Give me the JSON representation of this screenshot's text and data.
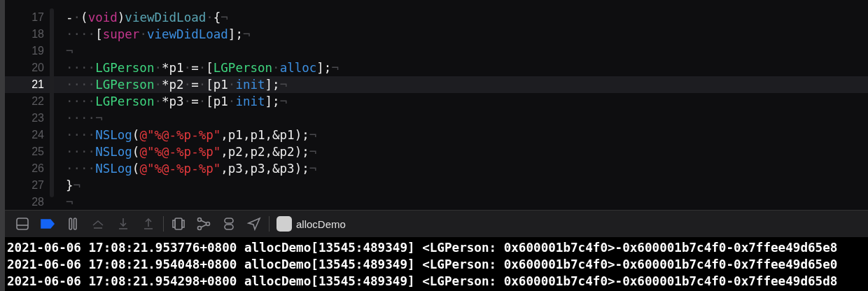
{
  "editor": {
    "lines": [
      {
        "number": "17",
        "selected": false,
        "tokens": [
          {
            "kind": "plain",
            "text": "-"
          },
          {
            "kind": "invisible",
            "text": "·"
          },
          {
            "kind": "plain",
            "text": "("
          },
          {
            "kind": "keyword",
            "text": "void"
          },
          {
            "kind": "plain",
            "text": ")"
          },
          {
            "kind": "decl",
            "text": "viewDidLoad"
          },
          {
            "kind": "invisible",
            "text": "·"
          },
          {
            "kind": "plain",
            "text": "{"
          },
          {
            "kind": "invisible",
            "text": "¬"
          }
        ]
      },
      {
        "number": "18",
        "selected": false,
        "tokens": [
          {
            "kind": "invisible",
            "text": "····"
          },
          {
            "kind": "plain",
            "text": "["
          },
          {
            "kind": "keyword",
            "text": "super"
          },
          {
            "kind": "invisible",
            "text": "·"
          },
          {
            "kind": "method",
            "text": "viewDidLoad"
          },
          {
            "kind": "plain",
            "text": "];"
          },
          {
            "kind": "invisible",
            "text": "¬"
          }
        ]
      },
      {
        "number": "19",
        "selected": false,
        "tokens": [
          {
            "kind": "invisible",
            "text": "¬"
          }
        ]
      },
      {
        "number": "20",
        "selected": false,
        "tokens": [
          {
            "kind": "invisible",
            "text": "····"
          },
          {
            "kind": "class",
            "text": "LGPerson"
          },
          {
            "kind": "invisible",
            "text": "·"
          },
          {
            "kind": "plain",
            "text": "*p1"
          },
          {
            "kind": "invisible",
            "text": "·"
          },
          {
            "kind": "plain",
            "text": "="
          },
          {
            "kind": "invisible",
            "text": "·"
          },
          {
            "kind": "plain",
            "text": "["
          },
          {
            "kind": "class",
            "text": "LGPerson"
          },
          {
            "kind": "invisible",
            "text": "·"
          },
          {
            "kind": "method",
            "text": "alloc"
          },
          {
            "kind": "plain",
            "text": "];"
          },
          {
            "kind": "invisible",
            "text": "¬"
          }
        ]
      },
      {
        "number": "21",
        "selected": true,
        "tokens": [
          {
            "kind": "invisible",
            "text": "····"
          },
          {
            "kind": "class",
            "text": "LGPerson"
          },
          {
            "kind": "invisible",
            "text": "·"
          },
          {
            "kind": "plain",
            "text": "*p2"
          },
          {
            "kind": "invisible",
            "text": "·"
          },
          {
            "kind": "plain",
            "text": "="
          },
          {
            "kind": "invisible",
            "text": "·"
          },
          {
            "kind": "plain",
            "text": "[p1"
          },
          {
            "kind": "invisible",
            "text": "·"
          },
          {
            "kind": "method",
            "text": "init"
          },
          {
            "kind": "plain",
            "text": "];"
          },
          {
            "kind": "invisible",
            "text": "¬"
          }
        ]
      },
      {
        "number": "22",
        "selected": false,
        "tokens": [
          {
            "kind": "invisible",
            "text": "····"
          },
          {
            "kind": "class",
            "text": "LGPerson"
          },
          {
            "kind": "invisible",
            "text": "·"
          },
          {
            "kind": "plain",
            "text": "*p3"
          },
          {
            "kind": "invisible",
            "text": "·"
          },
          {
            "kind": "plain",
            "text": "="
          },
          {
            "kind": "invisible",
            "text": "·"
          },
          {
            "kind": "plain",
            "text": "[p1"
          },
          {
            "kind": "invisible",
            "text": "·"
          },
          {
            "kind": "method",
            "text": "init"
          },
          {
            "kind": "plain",
            "text": "];"
          },
          {
            "kind": "invisible",
            "text": "¬"
          }
        ]
      },
      {
        "number": "23",
        "selected": false,
        "tokens": [
          {
            "kind": "invisible",
            "text": "····¬"
          }
        ]
      },
      {
        "number": "24",
        "selected": false,
        "tokens": [
          {
            "kind": "invisible",
            "text": "····"
          },
          {
            "kind": "method",
            "text": "NSLog"
          },
          {
            "kind": "plain",
            "text": "("
          },
          {
            "kind": "string",
            "text": "@\"%@-%p-%p\""
          },
          {
            "kind": "plain",
            "text": ",p1,p1,&p1);"
          },
          {
            "kind": "invisible",
            "text": "¬"
          }
        ]
      },
      {
        "number": "25",
        "selected": false,
        "tokens": [
          {
            "kind": "invisible",
            "text": "····"
          },
          {
            "kind": "method",
            "text": "NSLog"
          },
          {
            "kind": "plain",
            "text": "("
          },
          {
            "kind": "string",
            "text": "@\"%@-%p-%p\""
          },
          {
            "kind": "plain",
            "text": ",p2,p2,&p2);"
          },
          {
            "kind": "invisible",
            "text": "¬"
          }
        ]
      },
      {
        "number": "26",
        "selected": false,
        "tokens": [
          {
            "kind": "invisible",
            "text": "····"
          },
          {
            "kind": "method",
            "text": "NSLog"
          },
          {
            "kind": "plain",
            "text": "("
          },
          {
            "kind": "string",
            "text": "@\"%@-%p-%p\""
          },
          {
            "kind": "plain",
            "text": ",p3,p3,&p3);"
          },
          {
            "kind": "invisible",
            "text": "¬"
          }
        ]
      },
      {
        "number": "27",
        "selected": false,
        "tokens": [
          {
            "kind": "plain",
            "text": "}"
          },
          {
            "kind": "invisible",
            "text": "¬"
          }
        ]
      },
      {
        "number": "28",
        "selected": false,
        "tokens": [
          {
            "kind": "invisible",
            "text": "¬"
          }
        ]
      }
    ]
  },
  "debug_bar": {
    "breakpoints_active": true,
    "scheme": "allocDemo"
  },
  "console": {
    "lines": [
      "2021-06-06 17:08:21.953776+0800 allocDemo[13545:489349] <LGPerson: 0x600001b7c4f0>-0x600001b7c4f0-0x7ffee49d65e8",
      "2021-06-06 17:08:21.954048+0800 allocDemo[13545:489349] <LGPerson: 0x600001b7c4f0>-0x600001b7c4f0-0x7ffee49d65e0",
      "2021-06-06 17:08:21.954298+0800 allocDemo[13545:489349] <LGPerson: 0x600001b7c4f0>-0x600001b7c4f0-0x7ffee49d65d8"
    ]
  }
}
